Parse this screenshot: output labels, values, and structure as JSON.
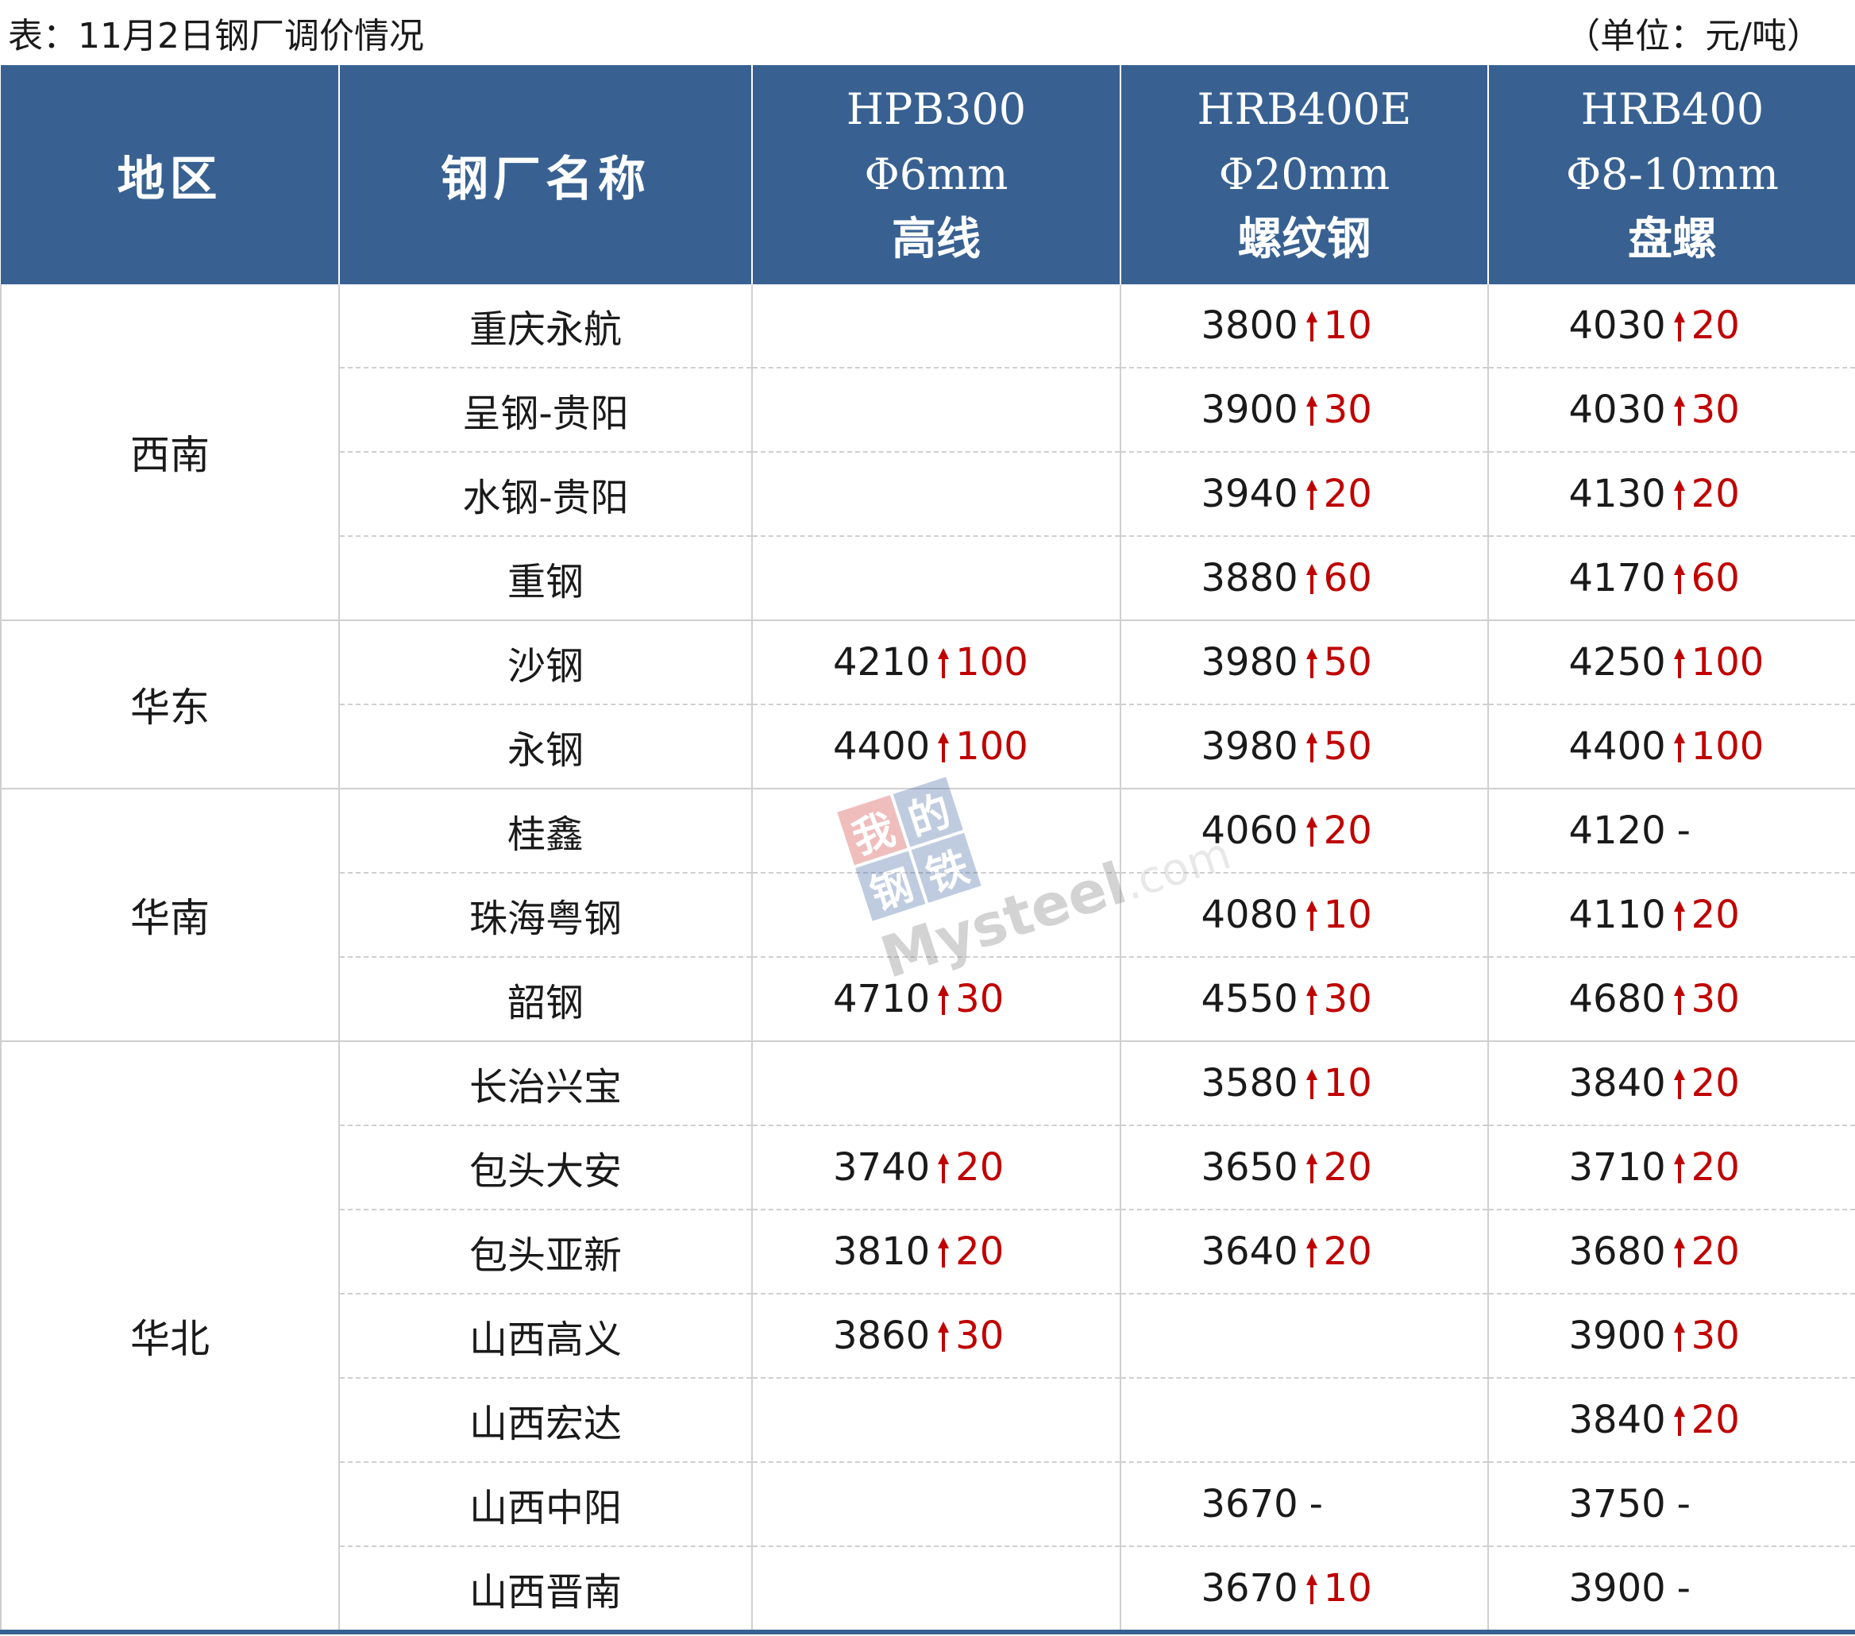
{
  "caption": {
    "left": "表：11月2日钢厂调价情况",
    "right": "（单位：元/吨）"
  },
  "header": {
    "region": "地区",
    "mill": "钢厂名称",
    "col3": [
      "HPB300",
      "Φ6mm",
      "高线"
    ],
    "col4": [
      "HRB400E",
      "Φ20mm",
      "螺纹钢"
    ],
    "col5": [
      "HRB400",
      "Φ8-10mm",
      "盘螺"
    ]
  },
  "watermark": {
    "cn": [
      "我",
      "的",
      "钢",
      "铁"
    ],
    "brand": "Mysteel",
    "domain": ".com"
  },
  "colors": {
    "header_bg": "#386192",
    "rise": "#c00000"
  },
  "icons": {
    "rise": "up-arrow-icon"
  },
  "groups": [
    {
      "region": "西南",
      "rows": [
        {
          "mill": "重庆永航",
          "c3": null,
          "c4": [
            "3800",
            "10"
          ],
          "c5": [
            "4030",
            "20"
          ]
        },
        {
          "mill": "呈钢-贵阳",
          "c3": null,
          "c4": [
            "3900",
            "30"
          ],
          "c5": [
            "4030",
            "30"
          ]
        },
        {
          "mill": "水钢-贵阳",
          "c3": null,
          "c4": [
            "3940",
            "20"
          ],
          "c5": [
            "4130",
            "20"
          ]
        },
        {
          "mill": "重钢",
          "c3": null,
          "c4": [
            "3880",
            "60"
          ],
          "c5": [
            "4170",
            "60"
          ]
        }
      ]
    },
    {
      "region": "华东",
      "rows": [
        {
          "mill": "沙钢",
          "c3": [
            "4210",
            "100"
          ],
          "c4": [
            "3980",
            "50"
          ],
          "c5": [
            "4250",
            "100"
          ]
        },
        {
          "mill": "永钢",
          "c3": [
            "4400",
            "100"
          ],
          "c4": [
            "3980",
            "50"
          ],
          "c5": [
            "4400",
            "100"
          ]
        }
      ]
    },
    {
      "region": "华南",
      "rows": [
        {
          "mill": "桂鑫",
          "c3": null,
          "c4": [
            "4060",
            "20"
          ],
          "c5": [
            "4120",
            "-"
          ]
        },
        {
          "mill": "珠海粤钢",
          "c3": null,
          "c4": [
            "4080",
            "10"
          ],
          "c5": [
            "4110",
            "20"
          ]
        },
        {
          "mill": "韶钢",
          "c3": [
            "4710",
            "30"
          ],
          "c4": [
            "4550",
            "30"
          ],
          "c5": [
            "4680",
            "30"
          ]
        }
      ]
    },
    {
      "region": "华北",
      "rows": [
        {
          "mill": "长治兴宝",
          "c3": null,
          "c4": [
            "3580",
            "10"
          ],
          "c5": [
            "3840",
            "20"
          ]
        },
        {
          "mill": "包头大安",
          "c3": [
            "3740",
            "20"
          ],
          "c4": [
            "3650",
            "20"
          ],
          "c5": [
            "3710",
            "20"
          ]
        },
        {
          "mill": "包头亚新",
          "c3": [
            "3810",
            "20"
          ],
          "c4": [
            "3640",
            "20"
          ],
          "c5": [
            "3680",
            "20"
          ]
        },
        {
          "mill": "山西高义",
          "c3": [
            "3860",
            "30"
          ],
          "c4": null,
          "c5": [
            "3900",
            "30"
          ]
        },
        {
          "mill": "山西宏达",
          "c3": null,
          "c4": null,
          "c5": [
            "3840",
            "20"
          ]
        },
        {
          "mill": "山西中阳",
          "c3": null,
          "c4": [
            "3670",
            "-"
          ],
          "c5": [
            "3750",
            "-"
          ]
        },
        {
          "mill": "山西晋南",
          "c3": null,
          "c4": [
            "3670",
            "10"
          ],
          "c5": [
            "3900",
            "-"
          ]
        }
      ]
    }
  ]
}
